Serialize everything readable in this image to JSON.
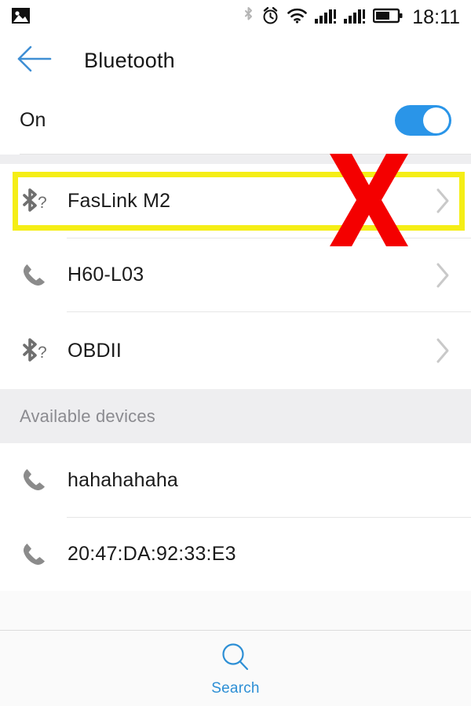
{
  "status_bar": {
    "left_icons": [
      "image-icon"
    ],
    "right_icons": [
      "bluetooth-icon",
      "alarm-icon",
      "wifi-icon",
      "signal-1-icon",
      "signal-2-icon",
      "battery-icon"
    ],
    "time": "18:11"
  },
  "title_bar": {
    "back_icon": "back-arrow-icon",
    "title": "Bluetooth"
  },
  "toggle": {
    "label": "On",
    "state": "on",
    "accent_color": "#2a95e8"
  },
  "paired_devices": [
    {
      "name": "FasLink M2",
      "icon": "bluetooth-unknown-icon",
      "chevron": "›",
      "highlighted": true
    },
    {
      "name": "H60-L03",
      "icon": "phone-handset-icon",
      "chevron": "›",
      "highlighted": false
    },
    {
      "name": "OBDII",
      "icon": "bluetooth-unknown-icon",
      "chevron": "›",
      "highlighted": false
    }
  ],
  "available_section": {
    "header": "Available devices",
    "devices": [
      {
        "name": "hahahahaha",
        "icon": "phone-handset-icon"
      },
      {
        "name": "20:47:DA:92:33:E3",
        "icon": "phone-handset-icon"
      }
    ]
  },
  "bottom_bar": {
    "icon": "search-icon",
    "label": "Search",
    "accent_color": "#2d8fd5"
  },
  "annotations": {
    "highlight_color": "#f5ee16",
    "x_mark_color": "#f40000",
    "x_mark_name": "red-x-mark"
  }
}
